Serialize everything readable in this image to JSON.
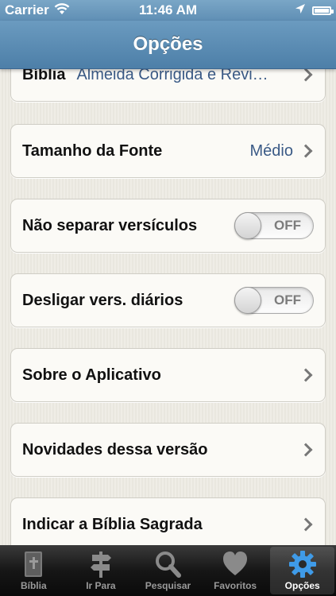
{
  "status_bar": {
    "carrier": "Carrier",
    "time": "11:46 AM"
  },
  "nav": {
    "title": "Opções"
  },
  "rows": {
    "biblia": {
      "label": "Bíblia",
      "value": "Almeida Corrigida e Revi…"
    },
    "fonte": {
      "label": "Tamanho da Fonte",
      "value": "Médio"
    },
    "separar": {
      "label": "Não separar versículos",
      "toggle": "OFF"
    },
    "desligar": {
      "label": "Desligar vers. diários",
      "toggle": "OFF"
    },
    "sobre": {
      "label": "Sobre o Aplicativo"
    },
    "novidades": {
      "label": "Novidades dessa versão"
    },
    "indicar": {
      "label": "Indicar a Bíblia Sagrada"
    }
  },
  "tabs": [
    {
      "label": "Bíblia",
      "icon": "bible-icon"
    },
    {
      "label": "Ir Para",
      "icon": "signpost-icon"
    },
    {
      "label": "Pesquisar",
      "icon": "search-icon"
    },
    {
      "label": "Favoritos",
      "icon": "heart-icon"
    },
    {
      "label": "Opções",
      "icon": "gear-icon"
    }
  ],
  "colors": {
    "nav_bar": "#5b8db4",
    "value_text": "#3a5a86",
    "active_tab_icon": "#3f9be8"
  }
}
